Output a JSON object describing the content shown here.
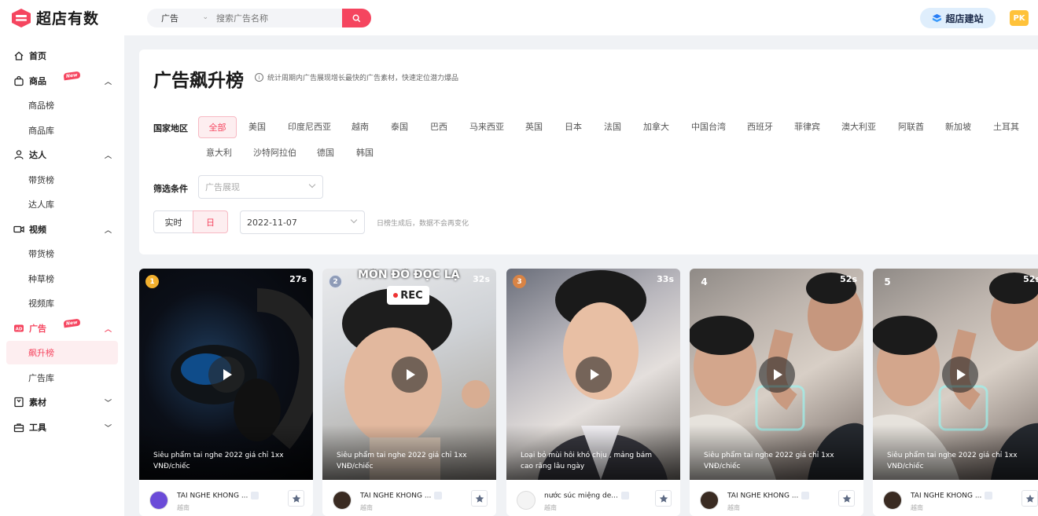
{
  "header": {
    "logo_text": "超店有数",
    "search_type": "广告",
    "search_placeholder": "搜索广告名称",
    "build_button": "超店建站",
    "user_initials": "PK"
  },
  "sidebar": {
    "home": "首页",
    "goods": "商品",
    "goods_badge": "New",
    "goods_rank": "商品榜",
    "goods_lib": "商品库",
    "creator": "达人",
    "creator_rank": "带货榜",
    "creator_lib": "达人库",
    "video": "视频",
    "video_rank": "带货榜",
    "video_grass": "种草榜",
    "video_lib": "视频库",
    "ads": "广告",
    "ads_badge": "New",
    "ads_rising": "飙升榜",
    "ads_lib": "广告库",
    "material": "素材",
    "tools": "工具"
  },
  "panel": {
    "title": "广告飙升榜",
    "note": "统计周期内广告展现增长最快的广告素材，快速定位潜力爆品",
    "region_label": "国家地区",
    "regions": [
      "全部",
      "美国",
      "印度尼西亚",
      "越南",
      "泰国",
      "巴西",
      "马来西亚",
      "英国",
      "日本",
      "法国",
      "加拿大",
      "中国台湾",
      "西班牙",
      "菲律宾",
      "澳大利亚",
      "阿联酋",
      "新加坡",
      "土耳其",
      "意大利",
      "沙特阿拉伯",
      "德国",
      "韩国"
    ],
    "filter_label": "筛选条件",
    "filter_value": "广告展现",
    "period_realtime": "实时",
    "period_day": "日",
    "date_value": "2022-11-07",
    "date_hint": "日榜生成后，数据不会再变化"
  },
  "cards": [
    {
      "rank": "1",
      "duration": "27s",
      "caption": "Siêu phẩm tai nghe 2022 giá chỉ 1xx VNĐ/chiếc",
      "shop": "TAI NGHE KHONG ...",
      "tag": "越南"
    },
    {
      "rank": "2",
      "duration": "32s",
      "caption": "Siêu phẩm tai nghe 2022 giá chỉ 1xx VNĐ/chiếc",
      "shop": "TAI NGHE KHONG ...",
      "tag": "越南",
      "overlay_top": "MÔN ĐỒ ĐỌC LẠ",
      "overlay_rec": "REC"
    },
    {
      "rank": "3",
      "duration": "33s",
      "caption": "Loại bỏ mùi hôi khó chịu , mảng bám cao răng lâu ngày",
      "shop": "nước súc miệng de...",
      "tag": "越南"
    },
    {
      "rank": "4",
      "duration": "52s",
      "caption": "Siêu phẩm tai nghe 2022 giá chỉ 1xx VNĐ/chiếc",
      "shop": "TAI NGHE KHONG ...",
      "tag": "越南"
    },
    {
      "rank": "5",
      "duration": "52s",
      "caption": "Siêu phẩm tai nghe 2022 giá chỉ 1xx VNĐ/chiếc",
      "shop": "TAI NGHE KHONG ...",
      "tag": "越南"
    }
  ]
}
